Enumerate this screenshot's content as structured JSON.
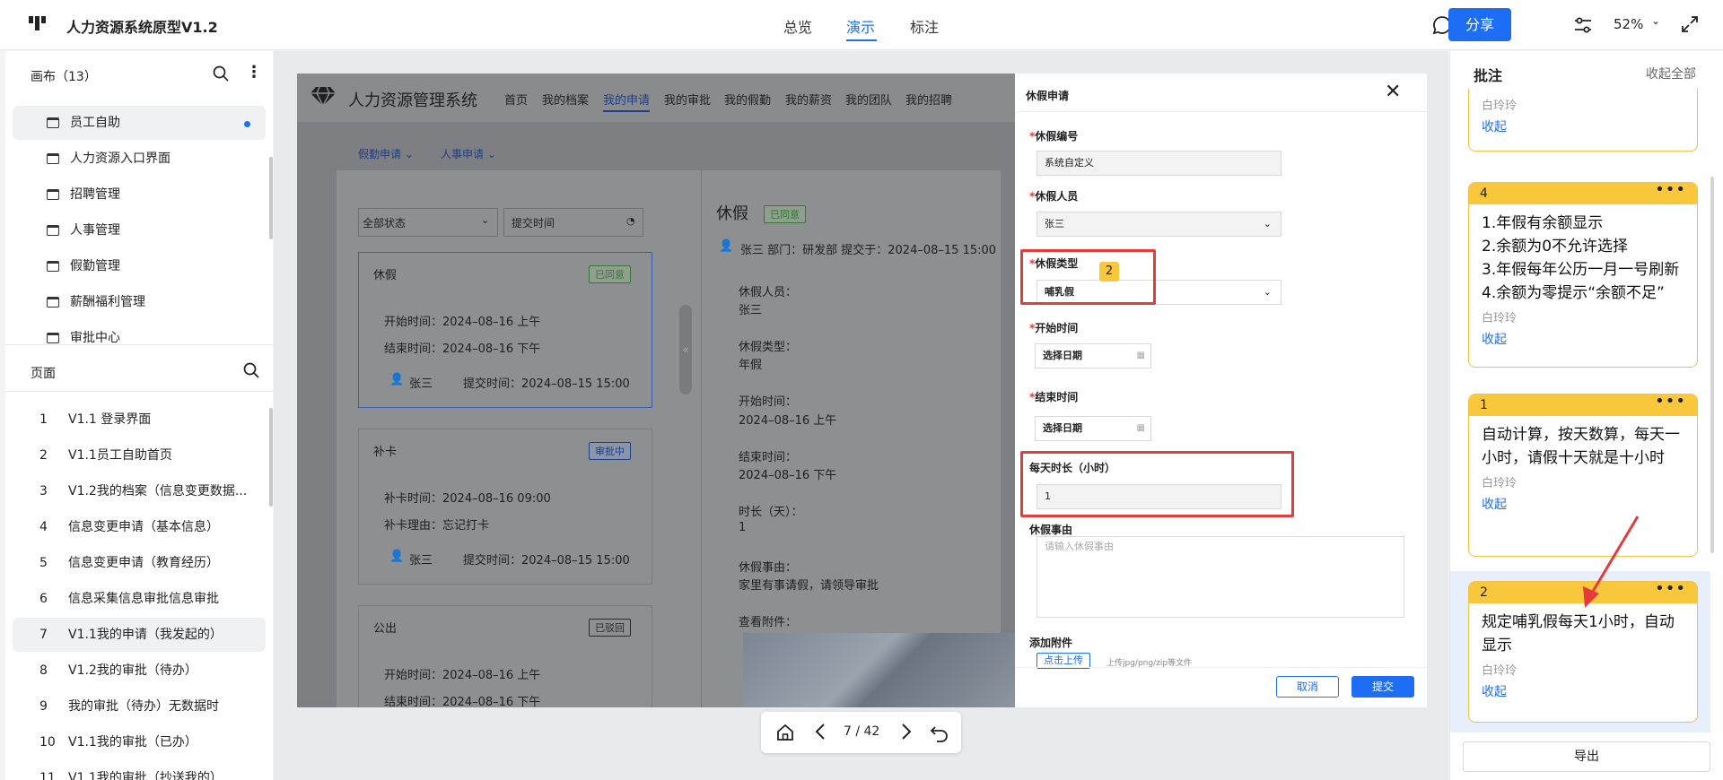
{
  "topbar": {
    "title": "人力资源系统原型V1.2",
    "tabs": [
      "总览",
      "演示",
      "标注"
    ],
    "active_tab": "演示",
    "share_label": "分享",
    "zoom": "52%"
  },
  "left": {
    "canvas_header": "画布（13）",
    "canvas_items": [
      "员工自助",
      "人力资源入口界面",
      "招聘管理",
      "人事管理",
      "假勤管理",
      "薪酬福利管理",
      "审批中心"
    ],
    "pages_header": "页面",
    "pages": [
      {
        "num": "1",
        "label": "V1.1 登录界面"
      },
      {
        "num": "2",
        "label": "V1.1员工自助首页"
      },
      {
        "num": "3",
        "label": "V1.2我的档案（信息变更数据..."
      },
      {
        "num": "4",
        "label": "信息变更申请（基本信息）"
      },
      {
        "num": "5",
        "label": "信息变更申请（教育经历）"
      },
      {
        "num": "6",
        "label": "信息采集信息审批信息审批"
      },
      {
        "num": "7",
        "label": "V1.1我的申请（我发起的）"
      },
      {
        "num": "8",
        "label": "V1.2我的审批（待办）"
      },
      {
        "num": "9",
        "label": "我的审批（待办）无数据时"
      },
      {
        "num": "10",
        "label": "V1.1我的审批（已办）"
      },
      {
        "num": "11",
        "label": "V1.1我的审批（抄送我的）"
      }
    ]
  },
  "proto": {
    "system_name": "人力资源管理系统",
    "nav": [
      "首页",
      "我的档案",
      "我的申请",
      "我的审批",
      "我的假勤",
      "我的薪资",
      "我的团队",
      "我的招聘"
    ],
    "subnav": [
      "假勤申请",
      "人事申请"
    ],
    "filter_status": "全部状态",
    "filter_time": "提交时间",
    "cards": [
      {
        "title": "休假",
        "badge": "已同意",
        "lines": [
          "开始时间：2024–08–16 上午",
          "结束时间：2024–08–16 下午"
        ],
        "user": "张三",
        "submit": "提交时间：2024–08–15 15:00"
      },
      {
        "title": "补卡",
        "badge": "审批中",
        "lines": [
          "补卡时间：2024–08–16 09:00",
          "补卡理由：忘记打卡"
        ],
        "user": "张三",
        "submit": "提交时间：2024–08–15 15:00"
      },
      {
        "title": "公出",
        "badge": "已驳回",
        "lines": [
          "开始时间：2024–08–16 上午",
          "结束时间：2024–08–16 下午"
        ],
        "user": "",
        "submit": ""
      }
    ],
    "detail": {
      "title": "休假",
      "badge": "已同意",
      "meta": "张三 部门：研发部  提交于：2024–08–15 15:00",
      "fields": [
        {
          "label": "休假人员：",
          "value": "张三"
        },
        {
          "label": "休假类型：",
          "value": "年假"
        },
        {
          "label": "开始时间：",
          "value": "2024–08–16 上午"
        },
        {
          "label": "结束时间：",
          "value": "2024–08–16 下午"
        },
        {
          "label": "时长（天）：",
          "value": "1"
        },
        {
          "label": "休假事由：",
          "value": "家里有事请假，请领导审批"
        },
        {
          "label": "查看附件：",
          "value": ""
        }
      ]
    },
    "modal": {
      "title": "休假申请",
      "no_label": "休假编号",
      "no_value": "系统自定义",
      "person_label": "休假人员",
      "person_value": "张三",
      "type_label": "休假类型",
      "type_value": "哺乳假",
      "start_label": "开始时间",
      "start_placeholder": "选择日期",
      "end_label": "结束时间",
      "end_placeholder": "选择日期",
      "daily_label": "每天时长（小时）",
      "daily_value": "1",
      "reason_label": "休假事由",
      "reason_placeholder": "请输入休假事由",
      "attach_label": "添加附件",
      "upload_label": "点击上传",
      "upload_hint": "上传jpg/png/zip等文件",
      "cancel_label": "取消",
      "submit_label": "提交",
      "marker": "2"
    }
  },
  "bottombar": {
    "page": "7 / 42"
  },
  "right": {
    "title": "批注",
    "collapse_all": "收起全部",
    "export_label": "导出",
    "partial_author": "白玲玲",
    "partial_fold": "收起",
    "notes": [
      {
        "num": "4",
        "lines": [
          "1.年假有余额显示",
          "2.余额为0不允许选择",
          "3.年假每年公历一月一号刷新",
          "4.余额为零提示“余额不足”"
        ],
        "author": "白玲玲",
        "fold": "收起"
      },
      {
        "num": "1",
        "lines": [
          "自动计算，按天数算，每天一小时，请假十天就是十小时"
        ],
        "author": "白玲玲",
        "fold": "收起"
      },
      {
        "num": "2",
        "lines": [
          "规定哺乳假每天1小时，自动显示"
        ],
        "author": "白玲玲",
        "fold": "收起"
      }
    ]
  }
}
